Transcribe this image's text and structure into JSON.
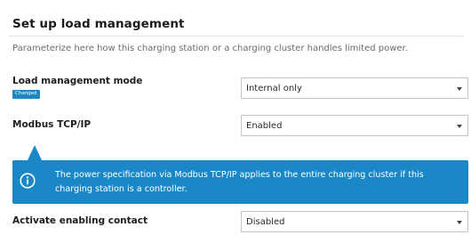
{
  "section": {
    "title": "Set up load management",
    "subtitle": "Parameterize here how this charging station or a charging cluster handles limited power."
  },
  "load_management": {
    "label": "Load management mode",
    "badge": "Changed",
    "value": "Internal only"
  },
  "modbus": {
    "label": "Modbus TCP/IP",
    "value": "Enabled"
  },
  "info": {
    "text": "The power specification via Modbus TCP/IP applies to the entire charging cluster if this charging station is a controller.",
    "icon": "info-icon"
  },
  "enabling_contact": {
    "label": "Activate enabling contact",
    "value": "Disabled"
  },
  "colors": {
    "accent": "#1a87c6",
    "border": "#c4c4c4"
  }
}
